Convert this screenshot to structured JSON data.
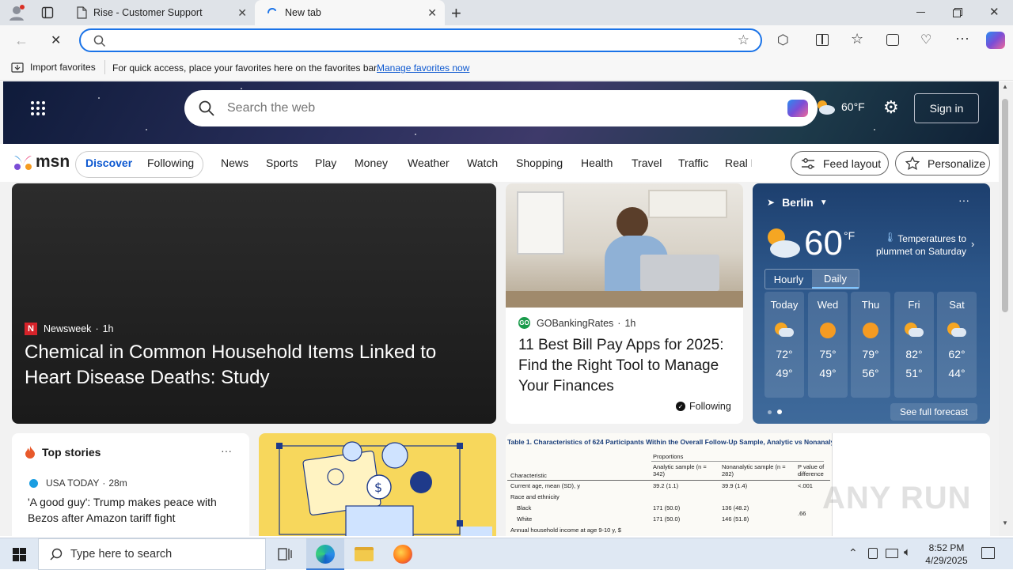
{
  "browser": {
    "tabs": [
      {
        "title": "Rise - Customer Support"
      },
      {
        "title": "New tab"
      }
    ],
    "address_placeholder": "",
    "favorites_bar": {
      "import_label": "Import favorites",
      "message": "For quick access, place your favorites here on the favorites bar.",
      "manage_link": "Manage favorites now"
    }
  },
  "msn": {
    "search_placeholder": "Search the web",
    "header_temp": "60°F",
    "sign_in": "Sign in",
    "logo": "msn",
    "nav": {
      "discover": "Discover",
      "following": "Following",
      "items": [
        "News",
        "Sports",
        "Play",
        "Money",
        "Weather",
        "Watch",
        "Shopping",
        "Health",
        "Travel",
        "Traffic",
        "Real E"
      ],
      "feed_layout": "Feed layout",
      "personalize": "Personalize"
    },
    "main_story": {
      "source": "Newsweek",
      "time": "1h",
      "headline": "Chemical in Common Household Items Linked to Heart Disease Deaths: Study"
    },
    "second_story": {
      "source": "GOBankingRates",
      "time": "1h",
      "headline": "11 Best Bill Pay Apps for 2025: Find the Right Tool to Manage Your Finances",
      "following": "Following"
    },
    "weather": {
      "city": "Berlin",
      "temp": "60",
      "unit": "°F",
      "alert": "Temperatures to plummet on Saturday",
      "tabs": [
        "Hourly",
        "Daily"
      ],
      "days": [
        {
          "name": "Today",
          "hi": "72°",
          "lo": "49°",
          "icon": "partly-cloudy-icon"
        },
        {
          "name": "Wed",
          "hi": "75°",
          "lo": "49°",
          "icon": "sun-icon"
        },
        {
          "name": "Thu",
          "hi": "79°",
          "lo": "56°",
          "icon": "sun-icon"
        },
        {
          "name": "Fri",
          "hi": "82°",
          "lo": "51°",
          "icon": "partly-cloudy-icon"
        },
        {
          "name": "Sat",
          "hi": "62°",
          "lo": "44°",
          "icon": "partly-cloudy-icon"
        }
      ],
      "see_full": "See full forecast"
    },
    "top_stories": {
      "title": "Top stories",
      "source": "USA TODAY",
      "time": "28m",
      "headline": "'A good guy': Trump makes peace with Bezos after Amazon tariff fight"
    },
    "table_card": {
      "title": "Table 1. Characteristics of 624 Participants Within the Overall Follow-Up Sample, Analytic vs Nonanalytic Sample",
      "col_group": "Proportions",
      "headers": [
        "Characteristic",
        "Analytic sample (n = 342)",
        "Nonanalytic sample (n = 282)",
        "P value of difference"
      ],
      "rows": [
        [
          "Current age, mean (SD), y",
          "39.2 (1.1)",
          "39.9 (1.4)",
          "<.001"
        ],
        [
          "Race and ethnicity",
          "",
          "",
          ""
        ],
        [
          "Black",
          "171 (50.0)",
          "136 (48.2)",
          ""
        ],
        [
          "White",
          "171 (50.0)",
          "146 (51.8)",
          ".66"
        ],
        [
          "Annual household income at age 9-10 y, $",
          "",
          "",
          ""
        ]
      ]
    },
    "watermark": "ANY RUN"
  },
  "taskbar": {
    "search_placeholder": "Type here to search",
    "time": "8:52 PM",
    "date": "4/29/2025"
  }
}
